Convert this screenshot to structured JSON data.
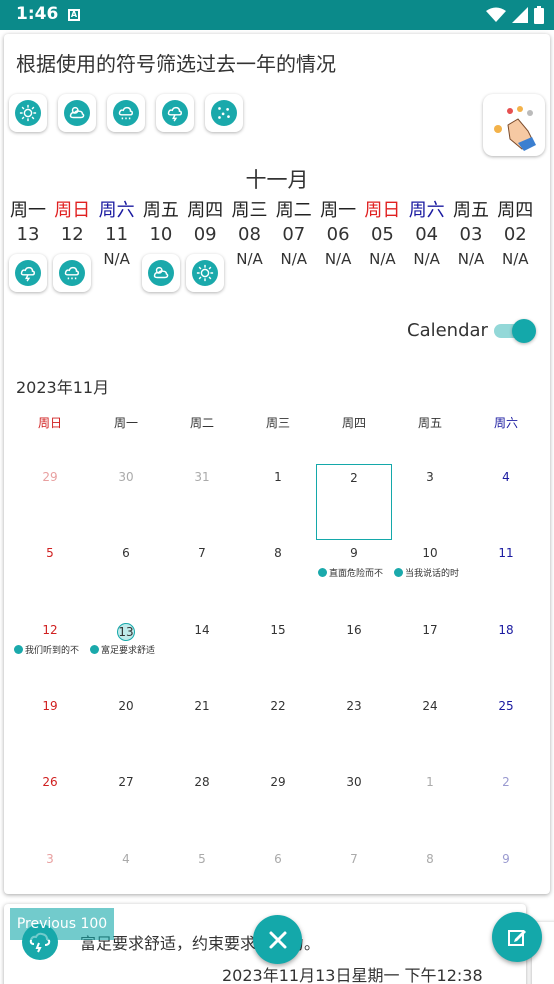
{
  "status_bar": {
    "time": "1:46",
    "badge": "A"
  },
  "title": "根据使用的符号筛选过去一年的情况",
  "symbols": [
    "sunny-icon",
    "partly-cloudy-icon",
    "rain-icon",
    "thunderstorm-icon",
    "snow-icon"
  ],
  "month": "十一月",
  "week_strip": [
    {
      "day": "周一",
      "date": "13",
      "type": "normal",
      "icon": "thunderstorm-icon",
      "na": ""
    },
    {
      "day": "周日",
      "date": "12",
      "type": "sun",
      "icon": "rain-icon",
      "na": ""
    },
    {
      "day": "周六",
      "date": "11",
      "type": "sat",
      "icon": "",
      "na": "N/A"
    },
    {
      "day": "周五",
      "date": "10",
      "type": "normal",
      "icon": "partly-cloudy-icon",
      "na": ""
    },
    {
      "day": "周四",
      "date": "09",
      "type": "normal",
      "icon": "sunny-icon",
      "na": ""
    },
    {
      "day": "周三",
      "date": "08",
      "type": "normal",
      "icon": "",
      "na": "N/A"
    },
    {
      "day": "周二",
      "date": "07",
      "type": "normal",
      "icon": "",
      "na": "N/A"
    },
    {
      "day": "周一",
      "date": "06",
      "type": "normal",
      "icon": "",
      "na": "N/A"
    },
    {
      "day": "周日",
      "date": "05",
      "type": "sun",
      "icon": "",
      "na": "N/A"
    },
    {
      "day": "周六",
      "date": "04",
      "type": "sat",
      "icon": "",
      "na": "N/A"
    },
    {
      "day": "周五",
      "date": "03",
      "type": "normal",
      "icon": "",
      "na": "N/A"
    },
    {
      "day": "周四",
      "date": "02",
      "type": "normal",
      "icon": "",
      "na": "N/A"
    }
  ],
  "calendar_toggle": {
    "label": "Calendar",
    "on": true
  },
  "calendar": {
    "header": "2023年11月",
    "weekdays": [
      "周日",
      "周一",
      "周二",
      "周三",
      "周四",
      "周五",
      "周六"
    ],
    "weeks": [
      [
        {
          "n": "29",
          "dim": true
        },
        {
          "n": "30",
          "dim": true
        },
        {
          "n": "31",
          "dim": true
        },
        {
          "n": "1"
        },
        {
          "n": "2",
          "selected": true
        },
        {
          "n": "3"
        },
        {
          "n": "4"
        }
      ],
      [
        {
          "n": "5"
        },
        {
          "n": "6"
        },
        {
          "n": "7"
        },
        {
          "n": "8"
        },
        {
          "n": "9",
          "event": "直面危险而不"
        },
        {
          "n": "10",
          "event": "当我说话的时"
        },
        {
          "n": "11"
        }
      ],
      [
        {
          "n": "12",
          "event": "我们听到的不"
        },
        {
          "n": "13",
          "today": true,
          "event": "富足要求舒适"
        },
        {
          "n": "14"
        },
        {
          "n": "15"
        },
        {
          "n": "16"
        },
        {
          "n": "17"
        },
        {
          "n": "18"
        }
      ],
      [
        {
          "n": "19"
        },
        {
          "n": "20"
        },
        {
          "n": "21"
        },
        {
          "n": "22"
        },
        {
          "n": "23"
        },
        {
          "n": "24"
        },
        {
          "n": "25"
        }
      ],
      [
        {
          "n": "26"
        },
        {
          "n": "27"
        },
        {
          "n": "28"
        },
        {
          "n": "29"
        },
        {
          "n": "30"
        },
        {
          "n": "1",
          "dim": true
        },
        {
          "n": "2",
          "dim": true
        }
      ],
      [
        {
          "n": "3",
          "dim": true
        },
        {
          "n": "4",
          "dim": true
        },
        {
          "n": "5",
          "dim": true
        },
        {
          "n": "6",
          "dim": true
        },
        {
          "n": "7",
          "dim": true
        },
        {
          "n": "8",
          "dim": true
        },
        {
          "n": "9",
          "dim": true
        }
      ]
    ]
  },
  "entry": {
    "text": "富足要求舒适，约束要求创造力。",
    "date": "2023年11月13日星期一 下午12:38"
  },
  "previous_button": "Previous 100",
  "colors": {
    "accent": "#14a8aa",
    "status_bar": "#0b8a8a",
    "sunday": "#e02020",
    "saturday": "#1a1aa0"
  }
}
